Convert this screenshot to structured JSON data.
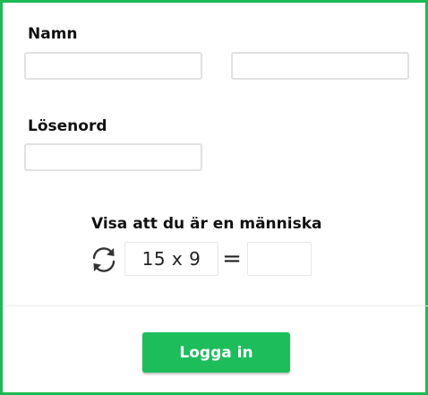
{
  "form": {
    "name_label": "Namn",
    "first_name_value": "",
    "last_name_value": "",
    "password_label": "Lösenord",
    "password_value": ""
  },
  "captcha": {
    "title": "Visa att du är en människa",
    "challenge": "15 x 9",
    "equals": "=",
    "answer_value": "",
    "refresh_icon": "refresh-icon"
  },
  "actions": {
    "login_label": "Logga in"
  },
  "colors": {
    "border_accent": "#1db954",
    "button_bg": "#1dbd5c",
    "button_text": "#ffffff",
    "field_border": "#e1e1e1"
  }
}
